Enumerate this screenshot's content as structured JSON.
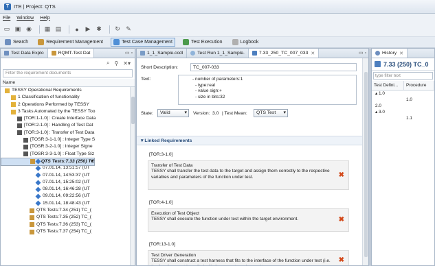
{
  "window": {
    "title": "ITE | Project: QTS"
  },
  "menu": [
    "File",
    "Window",
    "Help"
  ],
  "perspectives": [
    {
      "label": "Search",
      "color": "#6e8fbf",
      "active": false
    },
    {
      "label": "Requirement Management",
      "color": "#c9973c",
      "active": false
    },
    {
      "label": "Test Case Management",
      "color": "#4f8fd6",
      "active": true
    },
    {
      "label": "Test Execution",
      "color": "#4c9a4c",
      "active": false
    },
    {
      "label": "Logbook",
      "color": "#b0b0b0",
      "active": false
    }
  ],
  "left": {
    "tabs": [
      "Test Data Explo",
      "RQMT-Test Dat"
    ],
    "filter_placeholder": "Filter the requirement documents",
    "column": "Name",
    "tree": [
      {
        "label": "TESSY Operational Requirements",
        "indent": 0,
        "icon": "folder",
        "selected": false
      },
      {
        "label": "1 Classification of functionality",
        "indent": 1,
        "icon": "folder",
        "selected": false
      },
      {
        "label": "2 Operations Performed by TESSY",
        "indent": 1,
        "icon": "folder",
        "selected": false
      },
      {
        "label": "3 Tasks Automated by the TESSY Too",
        "indent": 1,
        "icon": "folder",
        "selected": false
      },
      {
        "label": "[TOR:1-1.0] : Create Interface Data",
        "indent": 2,
        "icon": "doc",
        "selected": false
      },
      {
        "label": "[TOR:2-1.0] : Handling of Test Dat",
        "indent": 2,
        "icon": "doc",
        "selected": false
      },
      {
        "label": "[TOR:3-1.0] : Transfer of Test Data",
        "indent": 2,
        "icon": "doc",
        "selected": false
      },
      {
        "label": "[TOSR:3-1-1.0] : Integer Type S",
        "indent": 3,
        "icon": "doc",
        "selected": false
      },
      {
        "label": "[TOSR:3-2-1.0] : Integer Signe",
        "indent": 3,
        "icon": "doc",
        "selected": false
      },
      {
        "label": "[TOSR:3-3-1.0] : Float Type Siz",
        "indent": 3,
        "icon": "doc",
        "selected": false
      },
      {
        "label": "> QTS Tests:7.33 (250) TC",
        "indent": 4,
        "icon": "test",
        "selected": true
      },
      {
        "label": "07.01.14, 12:34:07 (UT",
        "indent": 5,
        "icon": "run",
        "selected": false
      },
      {
        "label": "07.01.14, 13:51:57 (UT",
        "indent": 5,
        "icon": "run",
        "selected": false
      },
      {
        "label": "07.01.14, 14:53:37 (UT",
        "indent": 5,
        "icon": "run",
        "selected": false
      },
      {
        "label": "07.01.14, 15:25:02 (UT",
        "indent": 5,
        "icon": "run",
        "selected": false
      },
      {
        "label": "08.01.14, 16:46:28 (UT",
        "indent": 5,
        "icon": "run",
        "selected": false
      },
      {
        "label": "09.01.14, 09:22:56 (UT",
        "indent": 5,
        "icon": "run",
        "selected": false
      },
      {
        "label": "15.01.14, 18:48:43 (UT",
        "indent": 5,
        "icon": "run",
        "selected": false
      },
      {
        "label": "QTS Tests:7.34 (251) TC_(",
        "indent": 4,
        "icon": "test",
        "selected": false
      },
      {
        "label": "QTS Tests:7.35 (252) TC_(",
        "indent": 4,
        "icon": "test",
        "selected": false
      },
      {
        "label": "QTS Tests:7.36 (253) TC_(",
        "indent": 4,
        "icon": "test",
        "selected": false
      },
      {
        "label": "QTS Tests:7.37 (254) TC_(",
        "indent": 4,
        "icon": "test",
        "selected": false
      }
    ]
  },
  "mid": {
    "tabs": [
      {
        "label": "1_1_Sample.ccdl",
        "active": false,
        "closable": false
      },
      {
        "label": "Test Run 1_1_Sample.",
        "active": false,
        "closable": false
      },
      {
        "label": "7.33_250_TC_007_033",
        "active": true,
        "closable": true
      }
    ],
    "short_desc_label": "Short Description:",
    "short_desc_value": "TC_007-033",
    "text_label": "Text:",
    "text_lines": [
      "- number of parameters:1",
      "- type:real",
      "- value sign:+",
      "- size in bits:32"
    ],
    "state_label": "State:",
    "state_value": "Valid",
    "version_label": "Version:",
    "version_value": "3.0",
    "test_mean_label": "| Test Mean:",
    "test_mean_value": "QTS Test",
    "section_title": "Linked Requirements",
    "requirements": [
      {
        "id": "[TOR:3-1.0]",
        "title": "Transfer of Test Data",
        "desc": "TESSY shall transfer the test data to the target and assign them correctly to the respective variables and parameters of the function under test."
      },
      {
        "id": "[TOR:4-1.0]",
        "title": "Execution of Test Object",
        "desc": "TESSY shall execute the function under test within the target environment."
      },
      {
        "id": "[TOR:13-1.0]",
        "title": "Test Driver Generation",
        "desc": "TESSY shall construct a test harness that fits to the interface of the function under test (i.e. the function must be called with the correct number and type"
      }
    ]
  },
  "right": {
    "tab": "History",
    "title": "7.33 (250) TC_0",
    "filter_placeholder": "type filter text",
    "columns": [
      "Test Defini...",
      "Procedure"
    ],
    "rows": [
      {
        "c1": "▴ 1.0",
        "c2": ""
      },
      {
        "c1": "",
        "c2": "1.0"
      },
      {
        "c1": "2.0",
        "c2": ""
      },
      {
        "c1": "▴ 3.0",
        "c2": ""
      },
      {
        "c1": "",
        "c2": "1.1"
      }
    ]
  }
}
